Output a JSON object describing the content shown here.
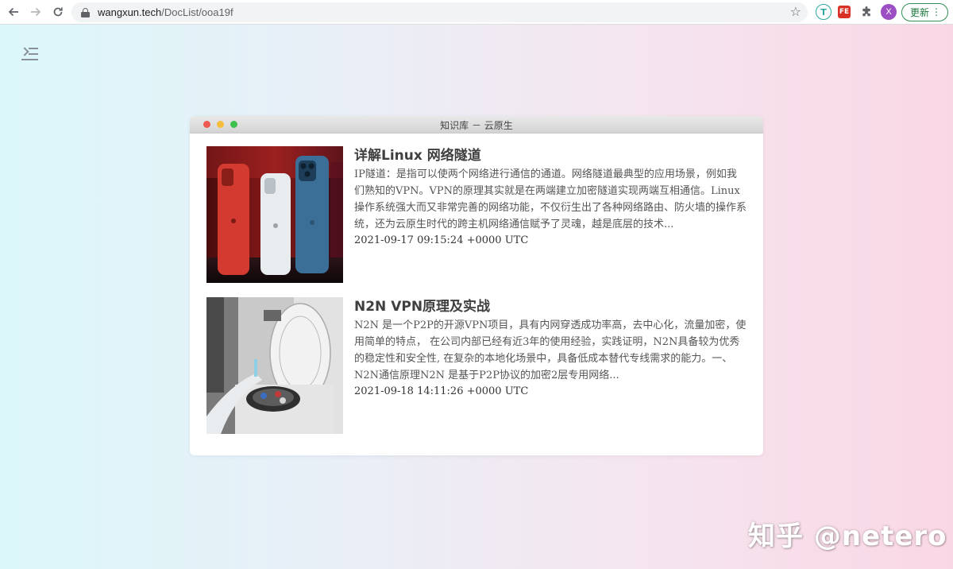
{
  "browser": {
    "url_host": "wangxun.tech",
    "url_path": "/DocList/ooa19f",
    "avatar_letter": "X",
    "update_label": "更新",
    "extensions": {
      "translate_label": "T",
      "fe_label": "FE"
    },
    "icons": [
      "back-arrow-icon",
      "forward-arrow-icon",
      "reload-icon",
      "lock-icon",
      "bookmark-star-icon",
      "puzzle-icon",
      "kebab-menu-icon"
    ]
  },
  "window": {
    "title": "知识库 － 云原生"
  },
  "articles": [
    {
      "title": "详解Linux 网络隧道",
      "excerpt": "IP隧道：是指可以使两个网络进行通信的通道。网络隧道最典型的应用场景，例如我们熟知的VPN。VPN的原理其实就是在两端建立加密隧道实现两端互相通信。Linux操作系统强大而又非常完善的网络功能，不仅衍生出了各种网络路由、防火墙的操作系统，还为云原生时代的跨主机网络通信赋予了灵魂，越是底层的技术...",
      "date": "2021-09-17 09:15:24 +0000 UTC",
      "thumb": "phones-photo"
    },
    {
      "title": "N2N VPN原理及实战",
      "excerpt": "N2N 是一个P2P的开源VPN项目，具有内网穿透成功率高，去中心化，流量加密，使用简单的特点， 在公司内部已经有近3年的使用经验，实践证明，N2N具备较为优秀的稳定性和安全性, 在复杂的本地化场景中，具备低成本替代专线需求的能力。一、 N2N通信原理N2N 是基于P2P协议的加密2层专用网络...",
      "date": "2021-09-18 14:11:26 +0000 UTC",
      "thumb": "lab-centrifuge-photo"
    }
  ],
  "watermark": "知乎 @netero",
  "colors": {
    "update_green": "#1e7b40",
    "avatar_purple": "#9c4fc2"
  }
}
